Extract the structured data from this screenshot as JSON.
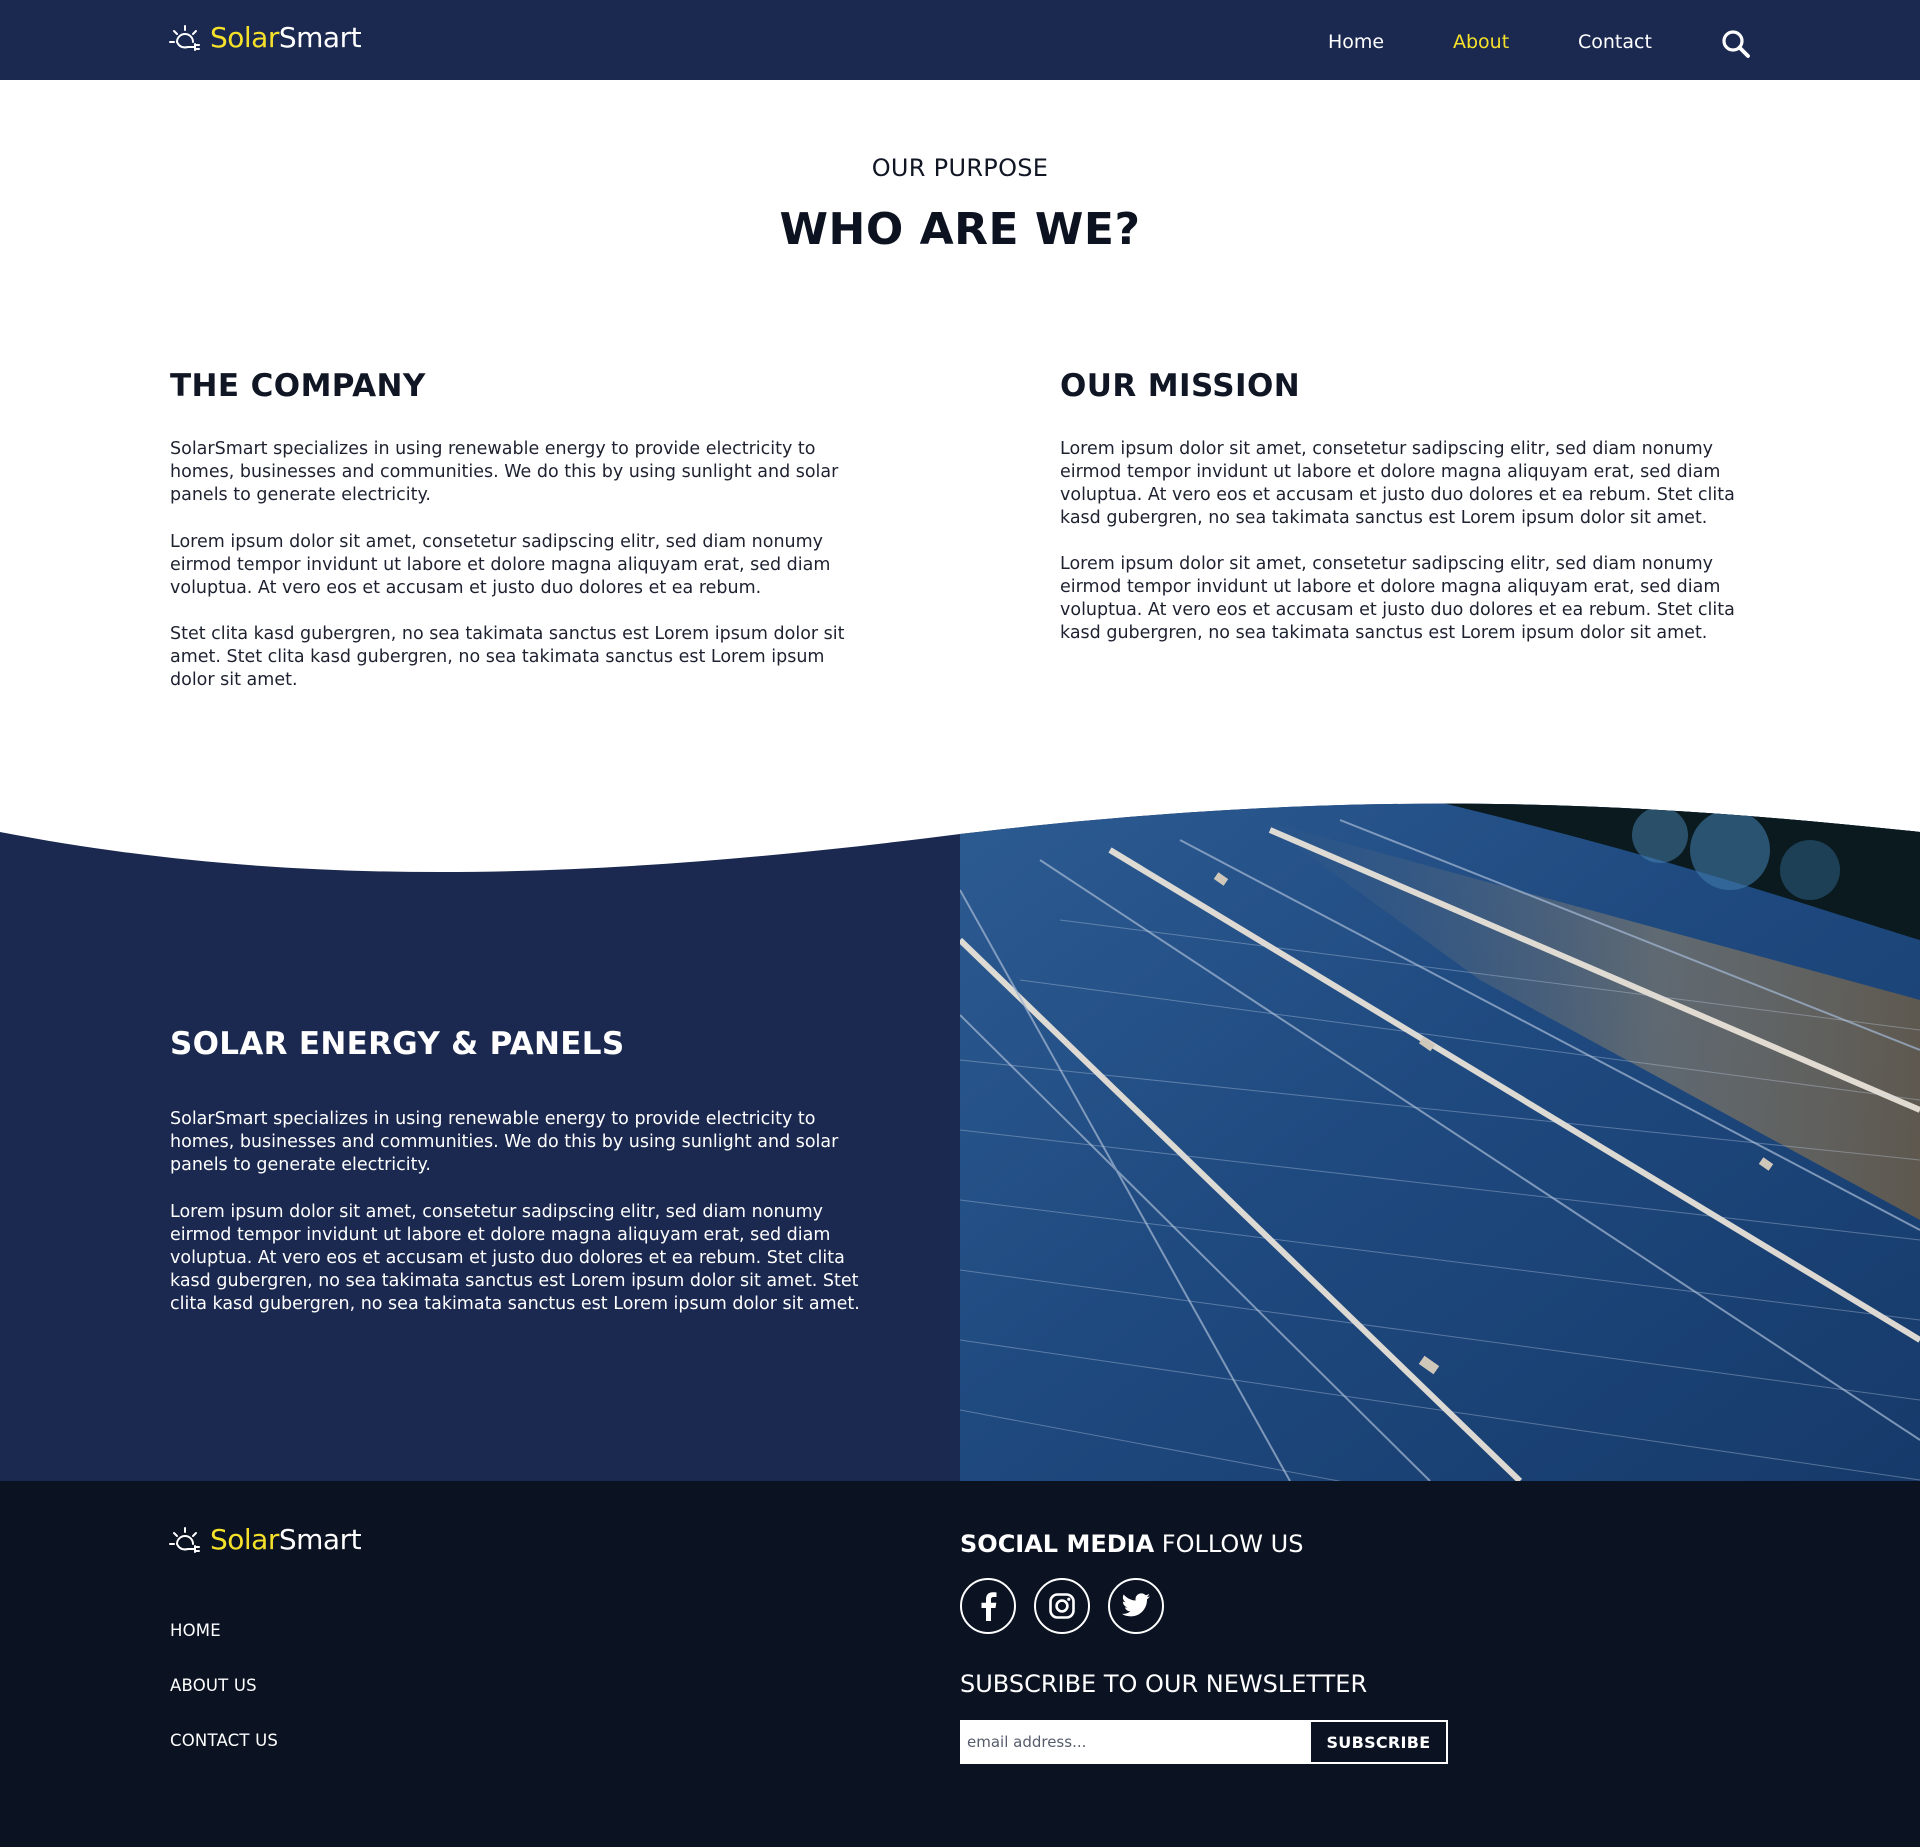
{
  "brand": {
    "name_highlight": "Solar",
    "name_rest": "Smart",
    "accent_color": "#f5e12a",
    "navy_color": "#1b2951",
    "footer_color": "#0b1222"
  },
  "nav": {
    "items": [
      {
        "label": "Home",
        "active": false
      },
      {
        "label": "About",
        "active": true
      },
      {
        "label": "Contact",
        "active": false
      }
    ],
    "search_icon": "search-icon"
  },
  "purpose": {
    "eyebrow": "OUR PURPOSE",
    "title": "WHO ARE WE?"
  },
  "company": {
    "title": "THE COMPANY",
    "paragraphs": [
      "SolarSmart specializes in using renewable energy to provide electricity to homes, businesses and communities. We do this by using sunlight and solar panels to generate electricity.",
      "Lorem ipsum dolor sit amet, consetetur sadipscing elitr, sed diam nonumy eirmod tempor invidunt ut labore et dolore magna aliquyam erat, sed diam voluptua. At vero eos et accusam et justo duo dolores et ea rebum.",
      "Stet clita kasd gubergren, no sea takimata sanctus est Lorem ipsum dolor sit amet. Stet clita kasd gubergren, no sea takimata sanctus est Lorem ipsum dolor sit amet."
    ]
  },
  "mission": {
    "title": "OUR MISSION",
    "paragraphs": [
      "Lorem ipsum dolor sit amet, consetetur sadipscing elitr, sed diam nonumy eirmod tempor invidunt ut labore et dolore magna aliquyam erat, sed diam voluptua. At vero eos et accusam et justo duo dolores et ea rebum. Stet clita kasd gubergren, no sea takimata sanctus est Lorem ipsum dolor sit amet.",
      "Lorem ipsum dolor sit amet, consetetur sadipscing elitr, sed diam nonumy eirmod tempor invidunt ut labore et dolore magna aliquyam erat, sed diam voluptua. At vero eos et accusam et justo duo dolores et ea rebum. Stet clita kasd gubergren, no sea takimata sanctus est Lorem ipsum dolor sit amet."
    ]
  },
  "solar": {
    "title": "SOLAR ENERGY & PANELS",
    "paragraphs": [
      "SolarSmart specializes in using renewable energy to provide electricity to homes, businesses and communities. We do this by using sunlight and solar panels to generate electricity.",
      "Lorem ipsum dolor sit amet, consetetur sadipscing elitr, sed diam nonumy eirmod tempor invidunt ut labore et dolore magna aliquyam erat, sed diam voluptua. At vero eos et accusam et justo duo dolores et ea rebum. Stet clita kasd gubergren, no sea takimata sanctus est Lorem ipsum dolor sit amet. Stet clita kasd gubergren, no sea takimata sanctus est Lorem ipsum dolor sit amet."
    ],
    "image": "solar-panels-photo"
  },
  "footer": {
    "links": [
      "HOME",
      "ABOUT US",
      "CONTACT US"
    ],
    "social_title_bold": "SOCIAL MEDIA",
    "social_title_rest": "FOLLOW US",
    "social_icons": [
      "facebook-icon",
      "instagram-icon",
      "twitter-icon"
    ],
    "newsletter_title": "SUBSCRIBE TO OUR NEWSLETTER",
    "email_placeholder": "email address...",
    "subscribe_label": "SUBSCRIBE"
  }
}
